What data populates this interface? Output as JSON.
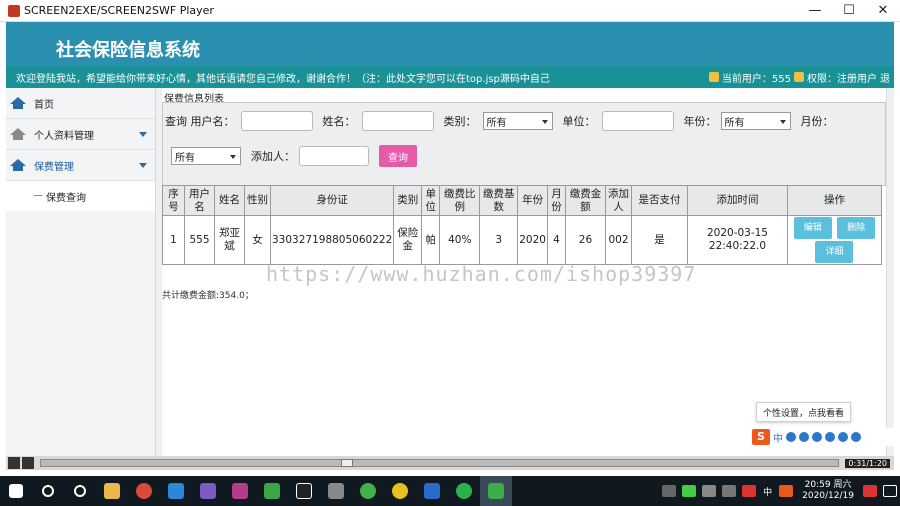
{
  "window": {
    "title": "SCREEN2EXE/SCREEN2SWF Player",
    "minimize": "—",
    "maximize": "☐",
    "close": "✕"
  },
  "header": {
    "system_title": "社会保险信息系统",
    "notice": "欢迎登陆我站，希望能给你带来好心情，其他话语请您自己修改，谢谢合作！（注：此处文字您可以在top.jsp源码中自己",
    "current_user_label": "当前用户：555",
    "permission_label": "权限：注册用户",
    "logout_label": "退"
  },
  "sidebar": {
    "items": [
      {
        "label": "首页"
      },
      {
        "label": "个人资料管理"
      },
      {
        "label": "保费管理"
      }
    ],
    "sub_items": [
      {
        "label": "保费查询"
      }
    ]
  },
  "main": {
    "list_title": "保费信息列表",
    "search": {
      "query_label": "查询 用户名：",
      "name_label": "姓名：",
      "category_label": "类别：",
      "category_value": "所有",
      "unit_label": "单位：",
      "year_label": "年份：",
      "year_value": "所有",
      "month_label": "月份：",
      "month_value": "所有",
      "adder_label": "添加人：",
      "query_button": "查询"
    },
    "table": {
      "headers": [
        "序号",
        "用户名",
        "姓名",
        "性别",
        "身份证",
        "类别",
        "单位",
        "缴费比例",
        "缴费基数",
        "年份",
        "月份",
        "缴费金额",
        "添加人",
        "是否支付",
        "添加时间",
        "操作"
      ],
      "rows": [
        {
          "cells": [
            "1",
            "555",
            "郑亚斌",
            "女",
            "330327198805060222",
            "保险金",
            "帕",
            "40%",
            "3",
            "2020",
            "4",
            "26",
            "002",
            "是",
            "2020-03-15 22:40:22.0"
          ],
          "actions": {
            "edit": "编辑",
            "delete": "删除",
            "detail": "详细"
          }
        }
      ]
    },
    "total": "共计缴费金额:354.0；"
  },
  "watermark": "https://www.huzhan.com/ishop39397",
  "ime": {
    "tooltip": "个性设置，点我看看",
    "logo": "S",
    "lang": "中"
  },
  "player": {
    "time": "0:31/1:20"
  },
  "taskbar": {
    "time": "20:59 周六",
    "date": "2020/12/19",
    "lang": "中"
  },
  "colors": {
    "header": "#2b8fb0",
    "notice_bar": "#1a9196",
    "query_button": "#e75aa6",
    "action_button": "#5bc0de"
  }
}
